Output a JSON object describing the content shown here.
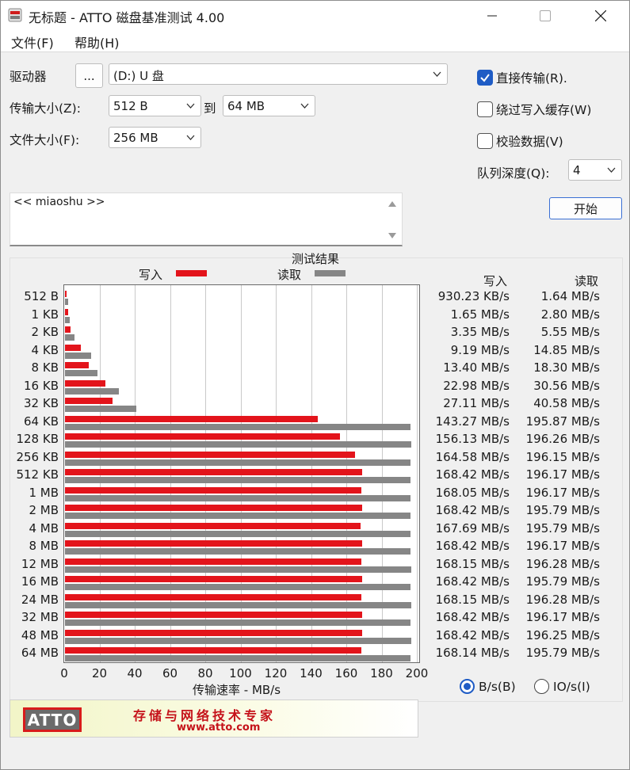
{
  "window": {
    "title": "无标题 - ATTO 磁盘基准测试 4.00"
  },
  "menu": [
    "文件(F)",
    "帮助(H)"
  ],
  "controls": {
    "drive_label": "驱动器",
    "browse_label": "...",
    "drive_value": "(D:) U 盘",
    "transfer_label": "传输大小(Z):",
    "transfer_from": "512 B",
    "to_label": "到",
    "transfer_to": "64 MB",
    "file_size_label": "文件大小(F):",
    "file_size_value": "256 MB",
    "direct_io_label": "直接传输(R).",
    "direct_io_checked": true,
    "bypass_cache_label": "绕过写入缓存(W)",
    "bypass_cache_checked": false,
    "verify_label": "校验数据(V)",
    "verify_checked": false,
    "queue_depth_label": "队列深度(Q):",
    "queue_depth_value": "4",
    "start_label": "开始",
    "description": "<< miaoshu >>"
  },
  "results": {
    "title": "测试结果",
    "legend_write": "写入",
    "legend_read": "读取",
    "col_write": "写入",
    "col_read": "读取",
    "xlabel": "传输速率 - MB/s",
    "unit_bytes_label": "B/s(B)",
    "unit_io_label": "IO/s(I)",
    "unit_selected": "B/s"
  },
  "chart_data": {
    "type": "bar",
    "orientation": "horizontal",
    "categories": [
      "512 B",
      "1 KB",
      "2 KB",
      "4 KB",
      "8 KB",
      "16 KB",
      "32 KB",
      "64 KB",
      "128 KB",
      "256 KB",
      "512 KB",
      "1 MB",
      "2 MB",
      "4 MB",
      "8 MB",
      "12 MB",
      "16 MB",
      "24 MB",
      "32 MB",
      "48 MB",
      "64 MB"
    ],
    "series": [
      {
        "name": "写入",
        "color": "#e3141b",
        "values": [
          0.93,
          1.65,
          3.35,
          9.19,
          13.4,
          22.98,
          27.11,
          143.27,
          156.13,
          164.58,
          168.42,
          168.05,
          168.42,
          167.69,
          168.42,
          168.15,
          168.42,
          168.15,
          168.42,
          168.42,
          168.14
        ]
      },
      {
        "name": "读取",
        "color": "#868686",
        "values": [
          1.64,
          2.8,
          5.55,
          14.85,
          18.3,
          30.56,
          40.58,
          195.87,
          196.26,
          196.15,
          196.17,
          196.17,
          195.79,
          195.79,
          196.17,
          196.28,
          195.79,
          196.28,
          196.17,
          196.25,
          195.79
        ]
      }
    ],
    "write_text": [
      "930.23 KB/s",
      "1.65 MB/s",
      "3.35 MB/s",
      "9.19 MB/s",
      "13.40 MB/s",
      "22.98 MB/s",
      "27.11 MB/s",
      "143.27 MB/s",
      "156.13 MB/s",
      "164.58 MB/s",
      "168.42 MB/s",
      "168.05 MB/s",
      "168.42 MB/s",
      "167.69 MB/s",
      "168.42 MB/s",
      "168.15 MB/s",
      "168.42 MB/s",
      "168.15 MB/s",
      "168.42 MB/s",
      "168.42 MB/s",
      "168.14 MB/s"
    ],
    "read_text": [
      "1.64 MB/s",
      "2.80 MB/s",
      "5.55 MB/s",
      "14.85 MB/s",
      "18.30 MB/s",
      "30.56 MB/s",
      "40.58 MB/s",
      "195.87 MB/s",
      "196.26 MB/s",
      "196.15 MB/s",
      "196.17 MB/s",
      "196.17 MB/s",
      "195.79 MB/s",
      "195.79 MB/s",
      "196.17 MB/s",
      "196.28 MB/s",
      "195.79 MB/s",
      "196.28 MB/s",
      "196.17 MB/s",
      "196.25 MB/s",
      "195.79 MB/s"
    ],
    "xticks": [
      "0",
      "20",
      "40",
      "60",
      "80",
      "100",
      "120",
      "140",
      "160",
      "180",
      "200"
    ],
    "xlim": [
      0,
      200
    ],
    "xlabel": "传输速率 - MB/s",
    "title": "测试结果",
    "grid": true,
    "legend": "top"
  },
  "banner": {
    "logo": "ATTO",
    "slogan": "存储与网络技术专家",
    "url": "www.atto.com"
  },
  "colors": {
    "accent": "#1f5cc5",
    "write": "#e3141b",
    "read": "#868686"
  }
}
